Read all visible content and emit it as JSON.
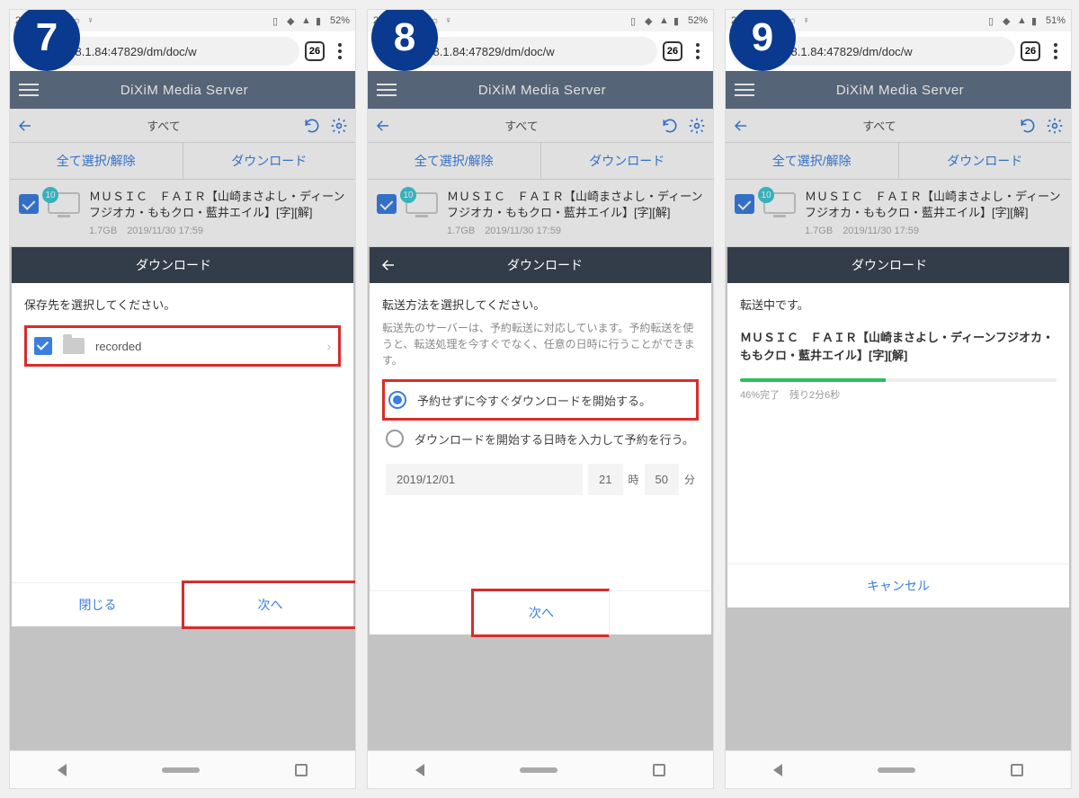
{
  "steps": [
    "7",
    "8",
    "9"
  ],
  "status": {
    "time_a": "21:35",
    "time_b": "21:35",
    "time_c": "21:37",
    "battery_a": "52%",
    "battery_b": "52%",
    "battery_c": "51%"
  },
  "browser": {
    "url": "92.168.1.84:47829/dm/doc/w",
    "tabs": "26"
  },
  "app": {
    "title": "DiXiM Media Server",
    "subheader_label": "すべて",
    "select_all": "全て選択/解除",
    "download_btn": "ダウンロード"
  },
  "item": {
    "badge": "10",
    "title": "ＭＵＳＩＣ　ＦＡＩＲ【山崎まさよし・ディーンフジオカ・ももクロ・藍井エイル】[字][解]",
    "meta_size": "1.7GB",
    "meta_date": "2019/11/30 17:59"
  },
  "dialog7": {
    "title": "ダウンロード",
    "prompt": "保存先を選択してください。",
    "folder": "recorded",
    "close": "閉じる",
    "next": "次へ"
  },
  "dialog8": {
    "title": "ダウンロード",
    "prompt": "転送方法を選択してください。",
    "desc": "転送先のサーバーは、予約転送に対応しています。予約転送を使うと、転送処理を今すぐでなく、任意の日時に行うことができます。",
    "radio1": "予約せずに今すぐダウンロードを開始する。",
    "radio2": "ダウンロードを開始する日時を入力して予約を行う。",
    "date": "2019/12/01",
    "hour": "21",
    "hour_unit": "時",
    "minute": "50",
    "minute_unit": "分",
    "next": "次へ"
  },
  "dialog9": {
    "title": "ダウンロード",
    "prompt": "転送中です。",
    "item_title": "ＭＵＳＩＣ　ＦＡＩＲ【山崎まさよし・ディーンフジオカ・ももクロ・藍井エイル】[字][解]",
    "progress_pct": 46,
    "progress_text": "46%完了　残り2分6秒",
    "cancel": "キャンセル"
  }
}
